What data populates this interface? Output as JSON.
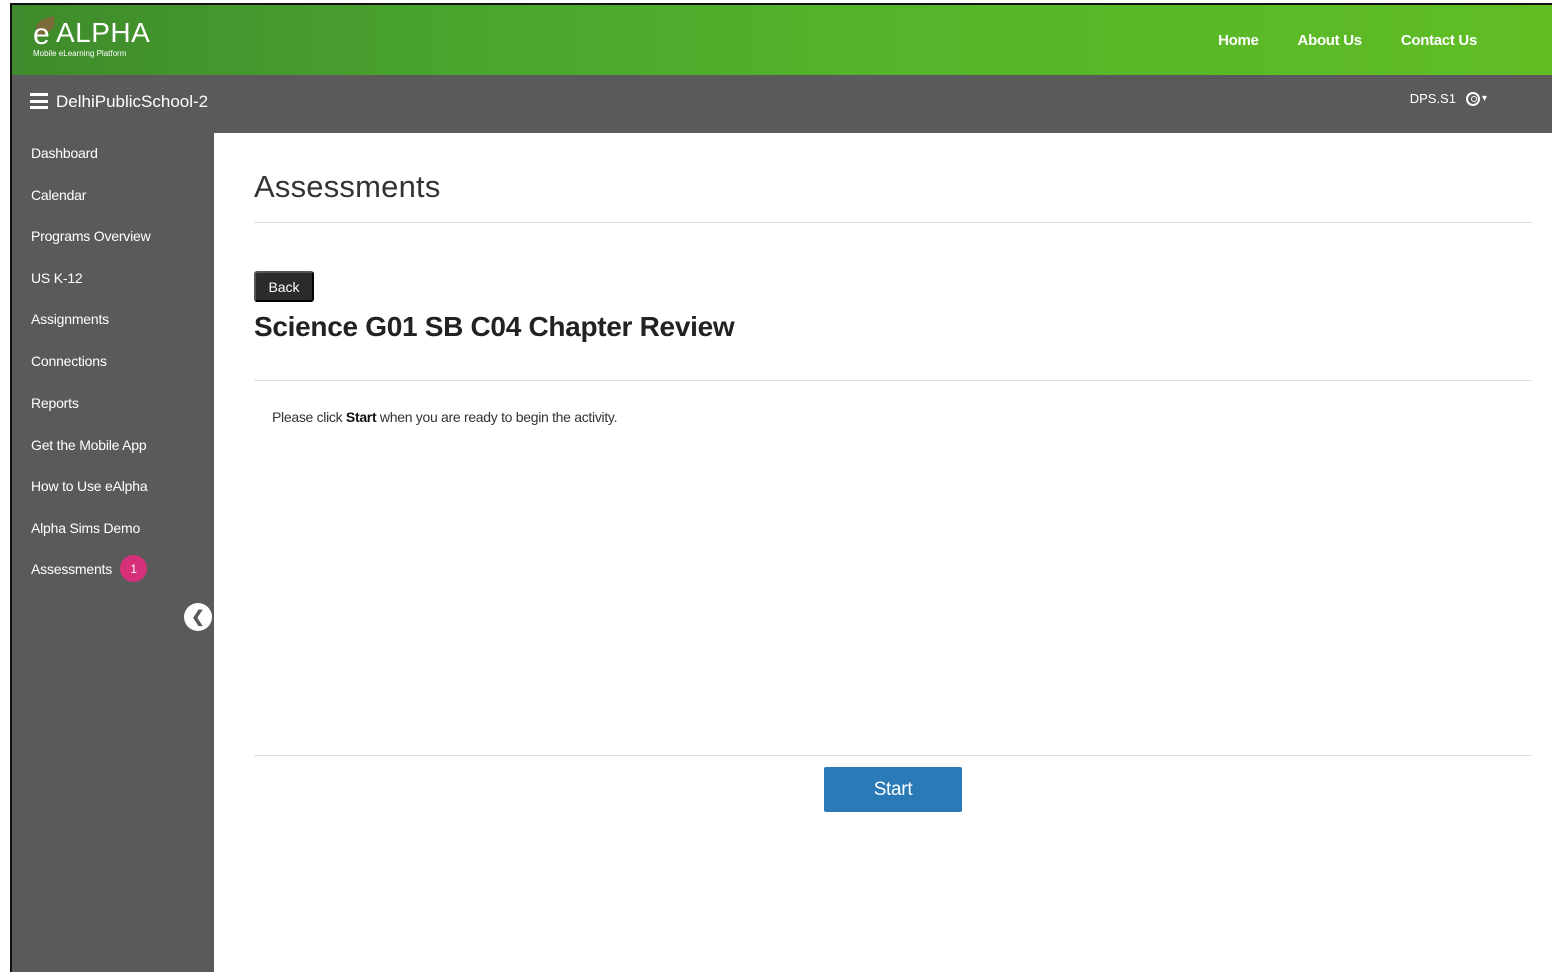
{
  "header": {
    "logo_text": "ALPHA",
    "logo_e": "e",
    "logo_tagline": "Mobile eLearning Platform",
    "nav": [
      {
        "label": "Home"
      },
      {
        "label": "About Us"
      },
      {
        "label": "Contact Us"
      }
    ]
  },
  "subbar": {
    "school_name": "DelhiPublicSchool-2",
    "user_name": "DPS.S1",
    "user_icon": "user-circle-icon",
    "dropdown_icon": "chevron-down-icon"
  },
  "sidebar": {
    "items": [
      {
        "label": "Dashboard"
      },
      {
        "label": "Calendar"
      },
      {
        "label": "Programs Overview"
      },
      {
        "label": "US K-12"
      },
      {
        "label": "Assignments"
      },
      {
        "label": "Connections"
      },
      {
        "label": "Reports"
      },
      {
        "label": "Get the Mobile App"
      },
      {
        "label": "How to Use eAlpha"
      },
      {
        "label": "Alpha Sims Demo"
      },
      {
        "label": "Assessments",
        "badge": "1"
      }
    ],
    "collapse_icon": "chevron-left-icon",
    "collapse_glyph": "❮"
  },
  "main": {
    "page_title": "Assessments",
    "back_label": "Back",
    "activity_title": "Science G01 SB C04 Chapter Review",
    "instruction_prefix": "Please click ",
    "instruction_bold": "Start",
    "instruction_suffix": " when you are ready to begin the activity.",
    "start_label": "Start"
  },
  "colors": {
    "header_green": "#4aa52e",
    "sidebar_gray": "#5a5a5a",
    "start_blue": "#2a7ab8",
    "badge_pink": "#d6307a",
    "back_dark": "#2b2b2b"
  }
}
